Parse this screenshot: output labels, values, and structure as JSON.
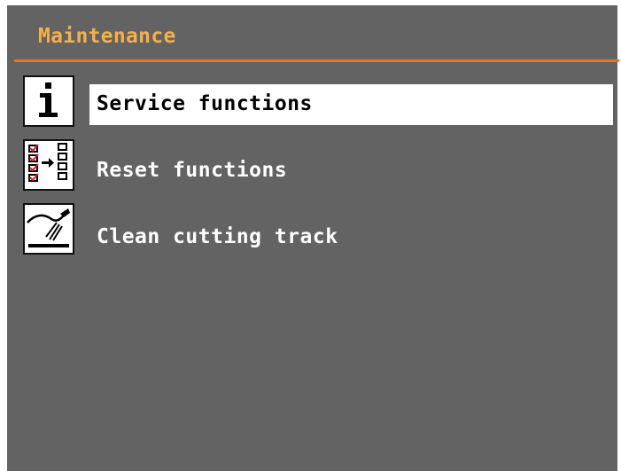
{
  "header": {
    "title": "Maintenance"
  },
  "colors": {
    "background": "#636363",
    "title": "#f5b047",
    "rule": "#ee7416",
    "selected_bg": "#ffffff"
  },
  "menu": {
    "selected_index": 0,
    "items": [
      {
        "label": "Service functions",
        "icon": "info-icon"
      },
      {
        "label": "Reset functions",
        "icon": "reset-checklist-icon"
      },
      {
        "label": "Clean cutting track",
        "icon": "clean-spray-icon"
      }
    ]
  }
}
